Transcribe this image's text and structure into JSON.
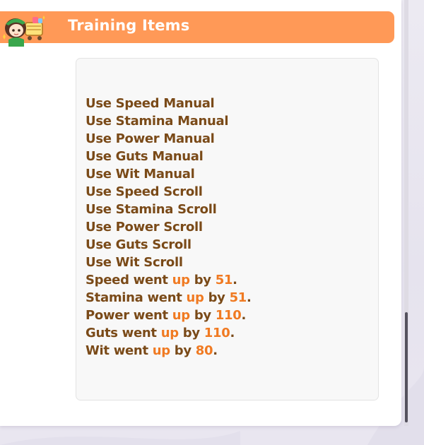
{
  "header": {
    "title": "Training Items"
  },
  "log": {
    "used_items": [
      "Use Speed Manual",
      "Use Stamina Manual",
      "Use Power Manual",
      "Use Guts Manual",
      "Use Wit Manual",
      "Use Speed Scroll",
      "Use Stamina Scroll",
      "Use Power Scroll",
      "Use Guts Scroll",
      "Use Wit Scroll"
    ],
    "stat_changes": [
      {
        "stat_text": "Speed went ",
        "direction": "up",
        "by_text": " by ",
        "amount": "51",
        "end": "."
      },
      {
        "stat_text": "Stamina went ",
        "direction": "up",
        "by_text": " by ",
        "amount": "51",
        "end": "."
      },
      {
        "stat_text": "Power went ",
        "direction": "up",
        "by_text": " by ",
        "amount": "110",
        "end": "."
      },
      {
        "stat_text": "Guts went ",
        "direction": "up",
        "by_text": " by ",
        "amount": "110",
        "end": "."
      },
      {
        "stat_text": "Wit went ",
        "direction": "up",
        "by_text": " by ",
        "amount": "80",
        "end": "."
      }
    ]
  },
  "colors": {
    "header_bg": "#ff9957",
    "text_brown": "#7a4a18",
    "highlight_orange": "#f07a22"
  },
  "icons": {
    "header_icon": "character-with-shopping-cart-icon"
  }
}
